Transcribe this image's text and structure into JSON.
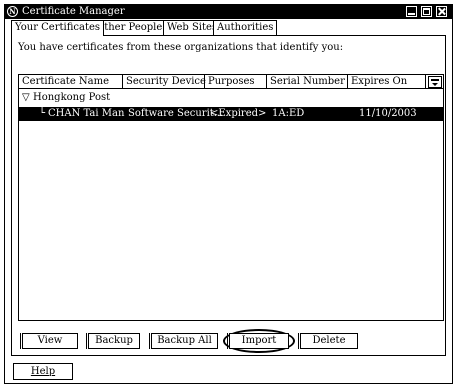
{
  "window": {
    "title": "Certificate Manager",
    "app_icon": "N"
  },
  "tabs": [
    {
      "label": "Your Certificates",
      "active": true
    },
    {
      "label": "Other People's",
      "active": false
    },
    {
      "label": "Web Sites",
      "active": false
    },
    {
      "label": "Authorities",
      "active": false
    }
  ],
  "intro_text": "You have certificates from these organizations that identify you:",
  "table": {
    "columns": [
      "Certificate Name",
      "Security Device",
      "Purposes",
      "Serial Number",
      "Expires On"
    ],
    "group": {
      "name": "Hongkong Post",
      "expanded_glyph": "▽"
    },
    "rows": [
      {
        "name": "CHAN Tai Man",
        "tree_glyph": "└",
        "security_device": "Software Securit...",
        "purposes": "<Expired>",
        "serial_number": "1A:ED",
        "expires_on": "11/10/2003",
        "selected": true
      }
    ]
  },
  "buttons": {
    "view": "View",
    "backup": "Backup",
    "backup_all": "Backup All",
    "import": "Import",
    "delete": "Delete",
    "help": "Help"
  },
  "icons": {
    "column_picker": "column-picker-icon"
  }
}
